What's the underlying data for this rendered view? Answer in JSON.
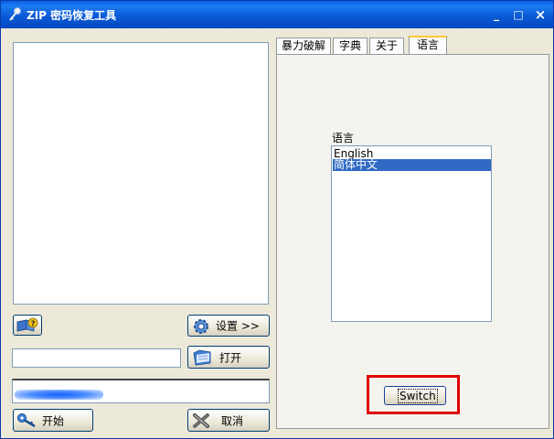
{
  "window": {
    "title": "ZIP 密码恢复工具",
    "minimize_glyph": "_",
    "maximize_glyph": "□",
    "close_glyph": "×"
  },
  "left": {
    "settings_button": "设置 >>",
    "open_button": "打开",
    "start_button": "开始",
    "cancel_button": "取消",
    "password_value": "",
    "progress_fraction": 0.35
  },
  "tabs": [
    {
      "label": "暴力破解"
    },
    {
      "label": "字典"
    },
    {
      "label": "关于"
    },
    {
      "label": "语言"
    }
  ],
  "active_tab_index": 3,
  "language_panel": {
    "label": "语言",
    "options": [
      "English",
      "简体中文"
    ],
    "selected_index": 1,
    "switch_button": "Switch"
  },
  "colors": {
    "accent": "#316ac5",
    "highlight_box": "#e00000",
    "titlebar": "#0a5ad6"
  },
  "icons": {
    "title": "key-icon",
    "help": "book-help-icon",
    "settings": "gear-icon",
    "open": "folder-open-icon",
    "start": "key-icon",
    "cancel": "cross-icon"
  }
}
